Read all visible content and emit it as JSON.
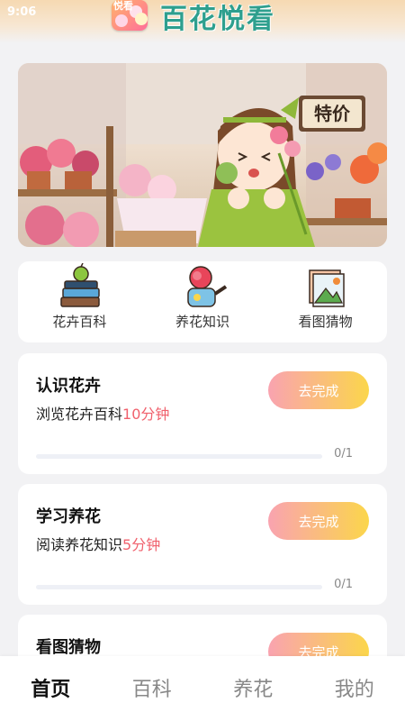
{
  "status_bar": {
    "time": "9:06"
  },
  "header": {
    "logo_text": "悦看",
    "app_title": "百花悦看"
  },
  "banner": {
    "sign_text": "特价",
    "dots": 3,
    "active_dot": 0
  },
  "categories": [
    {
      "label": "花卉百科",
      "icon": "book-apple-icon"
    },
    {
      "label": "养花知识",
      "icon": "watering-can-icon"
    },
    {
      "label": "看图猜物",
      "icon": "picture-frame-icon"
    }
  ],
  "tasks": [
    {
      "title": "认识花卉",
      "desc_prefix": "浏览花卉百科",
      "desc_highlight": "10分钟",
      "button": "去完成",
      "progress_text": "0/1",
      "progress": 0
    },
    {
      "title": "学习养花",
      "desc_prefix": "阅读养花知识",
      "desc_highlight": "5分钟",
      "button": "去完成",
      "progress_text": "0/1",
      "progress": 0
    },
    {
      "title": "看图猜物",
      "button": "去完成"
    }
  ],
  "tabbar": [
    {
      "label": "首页",
      "active": true
    },
    {
      "label": "百科",
      "active": false
    },
    {
      "label": "养花",
      "active": false
    },
    {
      "label": "我的",
      "active": false
    }
  ],
  "colors": {
    "brand_teal": "#2e9f8e",
    "highlight_red": "#f0606c",
    "button_start": "#f9a3b0",
    "button_end": "#fbd64b"
  }
}
